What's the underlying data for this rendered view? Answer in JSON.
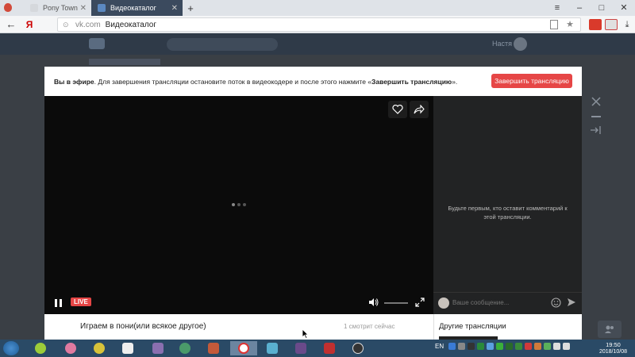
{
  "browser": {
    "tabs": [
      {
        "label": "Pony Town",
        "active": false
      },
      {
        "label": "Видеокаталог",
        "active": true
      }
    ],
    "new_tab": "+",
    "window_controls": [
      "≡",
      "–",
      "□",
      "✕"
    ],
    "address": {
      "host": "vk.com",
      "path": "Видеокаталог"
    }
  },
  "vk_header": {
    "user": "Настя"
  },
  "banner": {
    "bold_lead": "Вы в эфире",
    "text": ". Для завершения трансляции остановите поток в видеокодере и после этого нажмите «",
    "bold_action": "Завершить трансляцию",
    "text_end": "».",
    "button_label": "Завершить трансляцию"
  },
  "player": {
    "live_badge": "LIVE",
    "state": "loading"
  },
  "chat": {
    "empty_message": "Будьте первым, кто оставит комментарий к этой трансляции.",
    "input_placeholder": "Ваше сообщение..."
  },
  "stream_info": {
    "title": "Играем в пони(или всякое другое)",
    "viewers": "1 смотрит сейчас",
    "other_streams_title": "Другие трансляции"
  },
  "taskbar": {
    "language": "EN",
    "time": "19:50",
    "date": "2018/10/08"
  },
  "colors": {
    "accent_red": "#e64646",
    "vk_header": "#2f3a48",
    "taskbar": "#2a4a66"
  }
}
